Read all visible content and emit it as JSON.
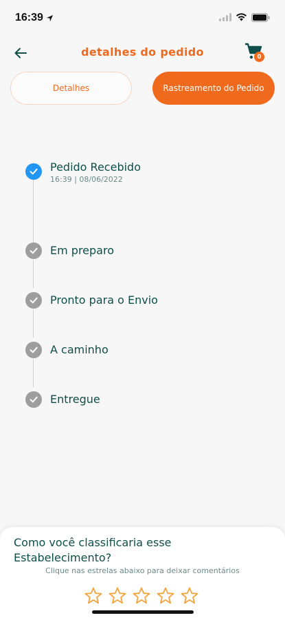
{
  "status_bar": {
    "time": "16:39"
  },
  "header": {
    "title": "detalhes do pedido",
    "cart_count": "0"
  },
  "tabs": [
    {
      "label": "Detalhes",
      "active": false
    },
    {
      "label": "Rastreamento do Pedido",
      "active": true
    }
  ],
  "timeline": {
    "steps": [
      {
        "label": "Pedido Recebido",
        "time": "16:39 | 08/06/2022",
        "done": true
      },
      {
        "label": "Em preparo",
        "done": false
      },
      {
        "label": "Pronto para o Envio",
        "done": false
      },
      {
        "label": "A caminho",
        "done": false
      },
      {
        "label": "Entregue",
        "done": false
      }
    ]
  },
  "rating": {
    "question": "Como você classificaria esse Estabelecimento?",
    "hint": "Clique nas estrelas abaixo para deixar comentários",
    "stars": 5,
    "value": 0
  },
  "colors": {
    "accent": "#f06a1e",
    "text": "#0e4f4a",
    "done": "#2196f3",
    "pending": "#9e9e9e",
    "star": "#f2a33c"
  }
}
